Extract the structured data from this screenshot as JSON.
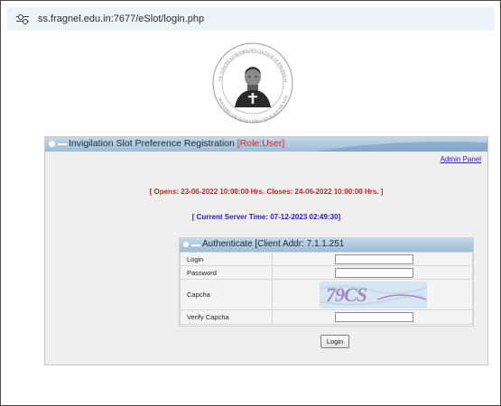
{
  "browser": {
    "url": "ss.fragnel.edu.in:7677/eSlot/login.php",
    "site_info_icon": "tune-icon"
  },
  "logo": {
    "icon": "college-seal-icon",
    "ring_text_top": "FR. CONCEICAO RODRIGUES COLLEGE OF ENGINEERING",
    "ring_text_bottom": "MOULDING ENGINEERS WHO CAN BUILD THE NATION"
  },
  "panel": {
    "title": "Invigilation Slot Preference Registration",
    "role": "[Role:User]",
    "admin_link": "Admin Panel",
    "opens_text": "[ Opens: 23-06-2022 10:00:00 Hrs. Closes: 24-06-2022 10:00:00 Hrs. ]",
    "server_time_text": "[ Current Server Time: 07-12-2023 02:49:30]"
  },
  "auth": {
    "title": "Authenticate [Client Addr: 7.1.1.251",
    "rows": [
      {
        "label": "Login",
        "value": ""
      },
      {
        "label": "Password",
        "value": ""
      },
      {
        "label": "Capcha"
      },
      {
        "label": "Verify Capcha",
        "value": ""
      }
    ],
    "captcha_text": "79CS",
    "login_button": "Login"
  },
  "colors": {
    "header_bar": "#9fbcd6",
    "role": "#e8202a",
    "opens": "#e02020",
    "server_time": "#2a20c8",
    "link": "#2a20c8"
  }
}
